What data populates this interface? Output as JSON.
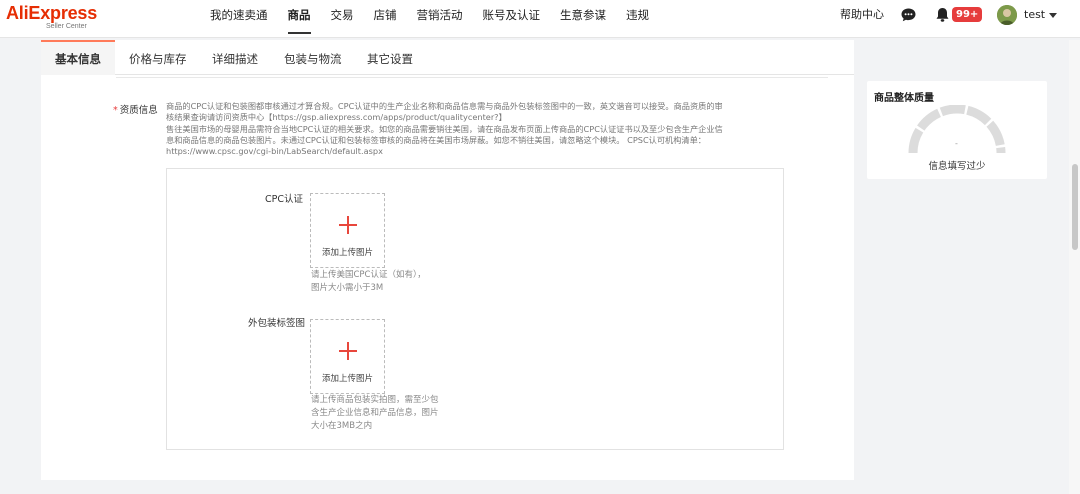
{
  "brand": {
    "name": "AliExpress",
    "sub": "Seller Center",
    "color": "#e62e04"
  },
  "nav": {
    "items": [
      {
        "label": "我的速卖通"
      },
      {
        "label": "商品",
        "active": true
      },
      {
        "label": "交易"
      },
      {
        "label": "店铺"
      },
      {
        "label": "营销活动"
      },
      {
        "label": "账号及认证"
      },
      {
        "label": "生意参谋"
      },
      {
        "label": "违规"
      }
    ],
    "help": "帮助中心",
    "notifications": "99+",
    "username": "test",
    "icons": [
      "chat-icon",
      "bell-icon",
      "avatar",
      "caret-down-icon"
    ]
  },
  "tabs": [
    {
      "label": "基本信息",
      "active": true
    },
    {
      "label": "价格与库存"
    },
    {
      "label": "详细描述"
    },
    {
      "label": "包装与物流"
    },
    {
      "label": "其它设置"
    }
  ],
  "qualification": {
    "label": "资质信息",
    "required_mark": "*",
    "desc_line1": "商品的CPC认证和包装图都审核通过才算合规。CPC认证中的生产企业名称和商品信息需与商品外包装标签图中的一致，英文谐音可以接受。商品资质的审",
    "desc_line2": "核结果查询请访问资质中心【https://gsp.aliexpress.com/apps/product/qualitycenter?】",
    "desc_line3": "售往美国市场的母婴用品需符合当地CPC认证的相关要求。如您的商品需要销往美国，请在商品发布页面上传商品的CPC认证证书以及至少包含生产企业信",
    "desc_line4": "息和商品信息的商品包装图片。未通过CPC认证和包装标签审核的商品将在美国市场屏蔽。如您不销往美国，请忽略这个模块。 CPSC认可机构清单：",
    "desc_line5": "https://www.cpsc.gov/cgi-bin/LabSearch/default.aspx",
    "cpc": {
      "label": "CPC认证",
      "upload_text": "添加上传图片",
      "hint_line1": "请上传美国CPC认证（如有），",
      "hint_line2": "图片大小需小于3M"
    },
    "package": {
      "label": "外包装标签图",
      "upload_text": "添加上传图片",
      "hint_line1": "请上传商品包装实拍图，需至少包",
      "hint_line2": "含生产企业信息和产品信息，图片",
      "hint_line3": "大小在3MB之内"
    }
  },
  "quality": {
    "title": "商品整体质量",
    "score": "-",
    "status": "信息填写过少"
  },
  "colors": {
    "accent": "#ff7a59",
    "plus": "#e8473c",
    "badge": "#e63c3c"
  }
}
